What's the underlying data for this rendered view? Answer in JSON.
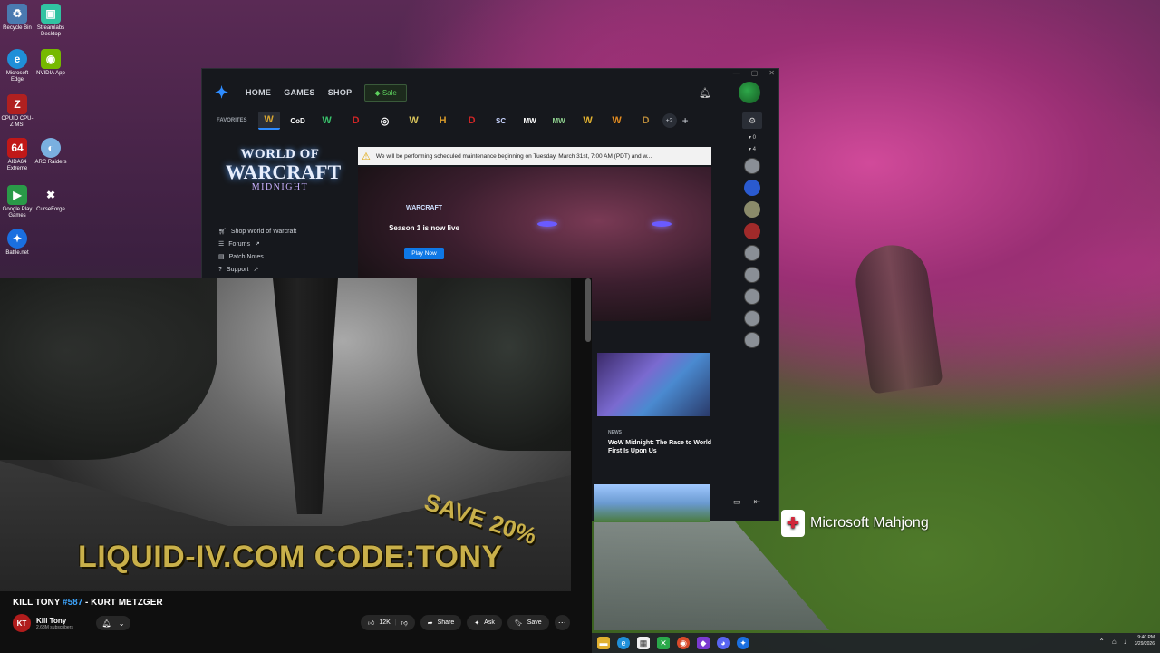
{
  "desktop": {
    "icons": [
      {
        "label": "Recycle Bin",
        "icon": "recycle-bin-icon"
      },
      {
        "label": "Streamlabs Desktop",
        "icon": "streamlabs-icon"
      },
      {
        "label": "Microsoft Edge",
        "icon": "edge-icon"
      },
      {
        "label": "NVIDIA App",
        "icon": "nvidia-icon"
      },
      {
        "label": "CPUID CPU-Z MSI",
        "icon": "cpuz-icon"
      },
      {
        "label": "AIDA64 Extreme",
        "icon": "aida64-icon"
      },
      {
        "label": "ARC Raiders",
        "icon": "arc-raiders-icon"
      },
      {
        "label": "Google Play Games",
        "icon": "google-play-icon"
      },
      {
        "label": "CurseForge",
        "icon": "curseforge-icon"
      },
      {
        "label": "Battle.net",
        "icon": "battlenet-icon"
      }
    ],
    "mahjong_label": "Microsoft Mahjong"
  },
  "bnet": {
    "nav": {
      "home": "HOME",
      "games": "GAMES",
      "shop": "SHOP",
      "sale": "Sale"
    },
    "favorites_label": "FAVORITES",
    "favorites": [
      {
        "glyph": "W",
        "color": "#d7a531",
        "icon": "wow-icon"
      },
      {
        "glyph": "CoD",
        "color": "#ffffff",
        "icon": "call-of-duty-icon"
      },
      {
        "glyph": "W",
        "color": "#38c06a",
        "icon": "wow-classic-icon"
      },
      {
        "glyph": "D",
        "color": "#d12626",
        "icon": "diablo-icon"
      },
      {
        "glyph": "◎",
        "color": "#ffffff",
        "icon": "overwatch-icon"
      },
      {
        "glyph": "W",
        "color": "#d7c25a",
        "icon": "warcraft-icon"
      },
      {
        "glyph": "H",
        "color": "#d79a2a",
        "icon": "hearthstone-icon"
      },
      {
        "glyph": "D",
        "color": "#d12626",
        "icon": "diablo-immortal-icon"
      },
      {
        "glyph": "SC",
        "color": "#c8d4ff",
        "icon": "starcraft-icon"
      },
      {
        "glyph": "MW",
        "color": "#ffffff",
        "icon": "modern-warfare-icon"
      },
      {
        "glyph": "MW",
        "color": "#8fd18f",
        "icon": "mw2-icon"
      },
      {
        "glyph": "W",
        "color": "#e0b030",
        "icon": "warcraft-rumble-icon"
      },
      {
        "glyph": "W",
        "color": "#e08a20",
        "icon": "warcraft-3-icon"
      },
      {
        "glyph": "D",
        "color": "#b88a3a",
        "icon": "diablo-2-icon"
      }
    ],
    "more_count": "+2",
    "maintenance": "We will be performing scheduled maintenance beginning on Tuesday, March 31st, 7:00 AM (PDT) and w...",
    "game": {
      "logo_line1": "WORLD OF",
      "logo_line2": "WARCRAFT",
      "logo_line3": "MIDNIGHT",
      "links": [
        "Shop World of Warcraft",
        "Forums",
        "Patch Notes",
        "Support"
      ]
    },
    "hero": {
      "mini_logo": "WARCRAFT",
      "title": "Season 1 is now live",
      "button": "Play Now"
    },
    "news": {
      "tag": "NEWS",
      "title": "WoW Midnight: The Race to World First Is Upon Us"
    },
    "friends": {
      "group1_count": "0",
      "group2_count": "4"
    }
  },
  "youtube": {
    "ad_line": "LIQUID-IV.COM CODE:TONY",
    "ad_save": "SAVE 20%",
    "title_prefix": "KILL TONY ",
    "title_hash": "#587",
    "title_suffix": " - KURT METZGER",
    "channel": "Kill Tony",
    "subscribers": "2.63M subscribers",
    "likes": "12K",
    "share": "Share",
    "ask": "Ask",
    "save": "Save"
  },
  "taskbar": {
    "time": "9:40 PM",
    "date": "3/29/2026"
  }
}
